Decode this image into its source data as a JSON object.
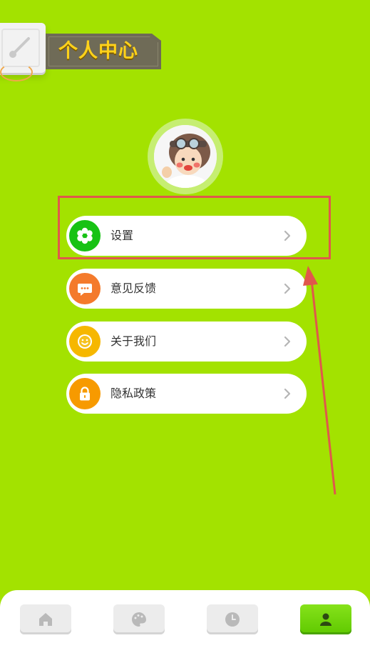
{
  "header": {
    "title": "个人中心",
    "title_color": "#ffd21a"
  },
  "avatar": {
    "icon": "pilot-avatar"
  },
  "menu": [
    {
      "label": "设置",
      "icon": "flower-gear-icon",
      "icon_color": "#1db81d"
    },
    {
      "label": "意见反馈",
      "icon": "chat-bubble-icon",
      "icon_color": "#f07a2a"
    },
    {
      "label": "关于我们",
      "icon": "smiley-icon",
      "icon_color": "#f5b800"
    },
    {
      "label": "隐私政策",
      "icon": "lock-icon",
      "icon_color": "#f59a00"
    }
  ],
  "annotation": {
    "highlight_color": "#e0584c",
    "target": "设置"
  },
  "bottom_nav": [
    {
      "name": "home",
      "icon": "home-icon",
      "active": false
    },
    {
      "name": "palette",
      "icon": "palette-icon",
      "active": false
    },
    {
      "name": "history",
      "icon": "clock-icon",
      "active": false
    },
    {
      "name": "profile",
      "icon": "user-icon",
      "active": true
    }
  ],
  "colors": {
    "background": "#a3e200",
    "active_nav": "#6fd40a"
  }
}
